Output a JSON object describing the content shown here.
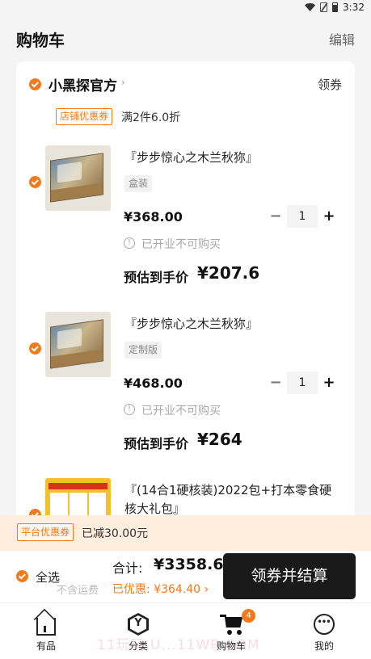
{
  "status_bar": {
    "time": "3:32",
    "icons": [
      "wifi-icon",
      "no-sim-icon",
      "battery-icon"
    ]
  },
  "header": {
    "title": "购物车",
    "edit_label": "编辑"
  },
  "shop": {
    "name": "小黑探官方",
    "coupon_label": "领券",
    "promo_tag": "店铺优惠券",
    "promo_text": "满2件6.0折"
  },
  "items": [
    {
      "title": "『步步惊心之木兰秋狝』",
      "variant": "盒装",
      "price": "¥368.00",
      "quantity": "1",
      "notice": "已开业不可购买",
      "estimate_label": "预估到手价",
      "estimate_price": "¥207.6"
    },
    {
      "title": "『步步惊心之木兰秋狝』",
      "variant": "定制版",
      "price": "¥468.00",
      "quantity": "1",
      "notice": "已开业不可购买",
      "estimate_label": "预估到手价",
      "estimate_price": "¥264"
    },
    {
      "title": "『(14合1硬核装)2022包+打本零食硬核大礼包』"
    }
  ],
  "stepper": {
    "minus": "−",
    "plus": "+"
  },
  "platform": {
    "tag": "平台优惠券",
    "text": "已减30.00元"
  },
  "checkout": {
    "select_all": "全选",
    "total_label": "合计:",
    "total_value": "¥3358.6",
    "shipping_note": "不含运费",
    "discount_note": "已优惠: ¥364.40 ›",
    "button": "领券并结算"
  },
  "tabs": [
    {
      "label": "有品",
      "icon": "home-icon"
    },
    {
      "label": "分类",
      "icon": "category-icon"
    },
    {
      "label": "购物车",
      "icon": "cart-icon",
      "badge": "4"
    },
    {
      "label": "我的",
      "icon": "profile-icon"
    }
  ],
  "watermark": "11玩玩.U...11WR.COM",
  "colors": {
    "accent": "#f07a1c",
    "button": "#1a1a1a",
    "platform_bg": "#fdeedd"
  }
}
